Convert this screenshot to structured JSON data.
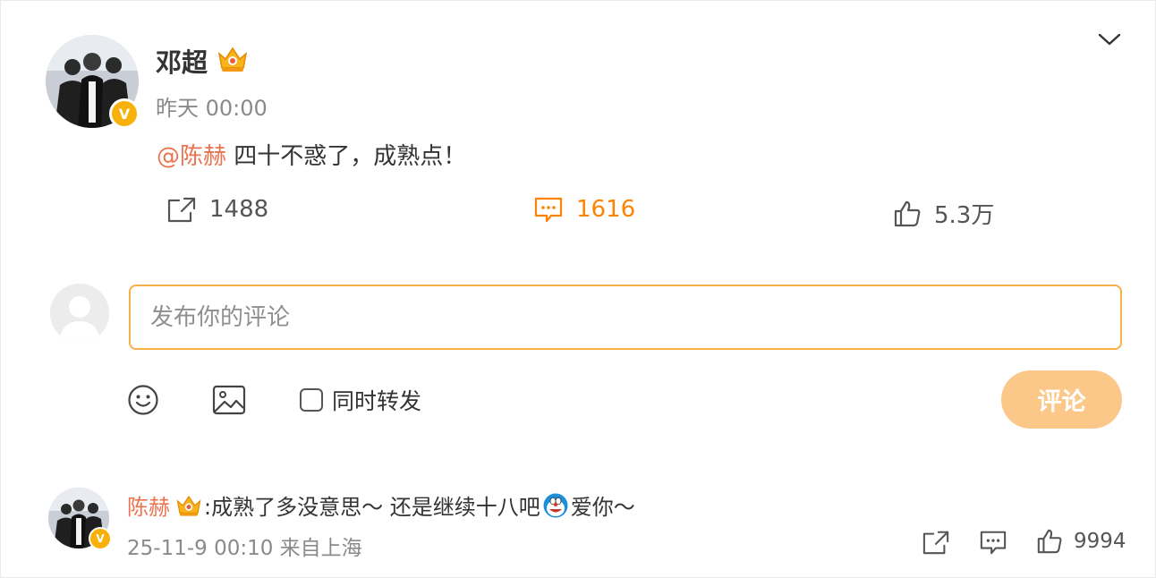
{
  "post": {
    "author": "邓超",
    "author_badge": "crown-badge-icon",
    "time": "昨天 00:00",
    "mention": "@陈赫",
    "text": " 四十不惑了，成熟点！",
    "stats": {
      "repost_count": "1488",
      "comment_count": "1616",
      "like_count": "5.3万"
    }
  },
  "composer": {
    "placeholder": "发布你的评论",
    "repost_label": "同时转发",
    "repost_checked": false,
    "submit_label": "评论"
  },
  "comment": {
    "author": "陈赫",
    "text_part1": ":成熟了多没意思～ 还是继续十八吧",
    "emoji": "doraemon-emoji-icon",
    "text_part2": " 爱你～",
    "meta": "25-11-9 00:10 来自上海",
    "like_count": "9994"
  },
  "colors": {
    "accent_orange": "#ff8200",
    "mention": "#eb7350",
    "input_border": "#f8b14a",
    "submit_bg": "#fcc889",
    "verified_badge": "#f7b10a"
  }
}
